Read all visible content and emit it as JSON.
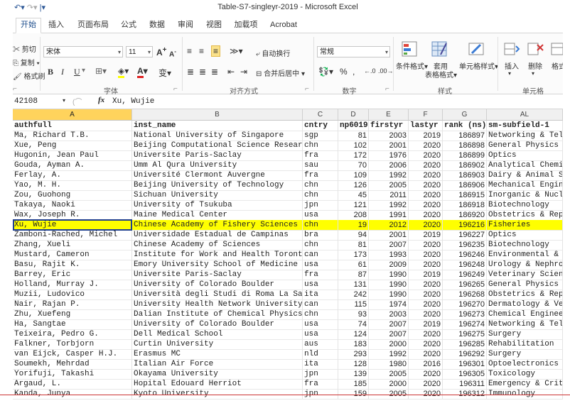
{
  "window": {
    "title": "Table-S7-singleyr-2019 - Microsoft Excel",
    "qat_icons": [
      "excel-app-icon",
      "undo-icon",
      "redo-icon",
      "customize-icon"
    ]
  },
  "tabs": [
    "开始",
    "插入",
    "页面布局",
    "公式",
    "数据",
    "审阅",
    "视图",
    "加载项",
    "Acrobat"
  ],
  "active_tab": "开始",
  "ribbon": {
    "clipboard": {
      "cut": "剪切",
      "copy": "复制",
      "format_painter": "格式刷",
      "label": ""
    },
    "font": {
      "name": "宋体",
      "size": "11",
      "grow": "A",
      "shrink": "A",
      "bold": "B",
      "italic": "I",
      "underline": "U",
      "phonetic": "变",
      "label": "字体"
    },
    "alignment": {
      "wrap": "自动换行",
      "merge": "合并后居中",
      "label": "对齐方式"
    },
    "number": {
      "format": "常规",
      "percent": "%",
      "comma": ",",
      "label": "数字"
    },
    "styles": {
      "conditional": "条件格式",
      "table": "套用\n表格格式",
      "cell": "单元格样式",
      "table_line1": "套用",
      "table_line2": "表格格式",
      "label": "样式"
    },
    "cells": {
      "insert": "插入",
      "delete": "删除",
      "format": "格式",
      "label": "单元格"
    }
  },
  "formula_bar": {
    "name_box": "42108",
    "fx": "fx",
    "content": "Xu, Wujie"
  },
  "columns": [
    {
      "letter": "A",
      "selected": true
    },
    {
      "letter": "B",
      "selected": false
    },
    {
      "letter": "C",
      "selected": false
    },
    {
      "letter": "D",
      "selected": false
    },
    {
      "letter": "E",
      "selected": false
    },
    {
      "letter": "F",
      "selected": false
    },
    {
      "letter": "G",
      "selected": false
    },
    {
      "letter": "AL",
      "selected": false
    }
  ],
  "headers": [
    "authfull",
    "inst_name",
    "cntry",
    "np6019",
    "firstyr",
    "lastyr",
    "rank (ns)",
    "sm-subfield-1"
  ],
  "rows": [
    [
      "Ma, Richard T.B.",
      "National University of Singapore",
      "sgp",
      "81",
      "2003",
      "2019",
      "186897",
      "Networking & Tel"
    ],
    [
      "Xue, Peng",
      "Beijing Computational Science Research",
      "chn",
      "102",
      "2001",
      "2020",
      "186898",
      "General Physics"
    ],
    [
      "Hugonin, Jean Paul",
      "Universite Paris-Saclay",
      "fra",
      "172",
      "1976",
      "2020",
      "186899",
      "Optics"
    ],
    [
      "Gouda, Ayman A.",
      "Umm Al Qura University",
      "sau",
      "70",
      "2006",
      "2020",
      "186902",
      "Analytical Chemi"
    ],
    [
      "Ferlay, A.",
      "Université Clermont Auvergne",
      "fra",
      "109",
      "1992",
      "2020",
      "186903",
      "Dairy & Animal S"
    ],
    [
      "Yao, M. H.",
      "Beijing University of Technology",
      "chn",
      "126",
      "2005",
      "2020",
      "186906",
      "Mechanical Engin"
    ],
    [
      "Zou, Guohong",
      "Sichuan University",
      "chn",
      "45",
      "2011",
      "2020",
      "186915",
      "Inorganic & Nucl"
    ],
    [
      "Takaya, Naoki",
      "University of Tsukuba",
      "jpn",
      "121",
      "1992",
      "2020",
      "186918",
      "Biotechnology"
    ],
    [
      "Wax, Joseph R.",
      "Maine Medical Center",
      "usa",
      "208",
      "1991",
      "2020",
      "186920",
      "Obstetrics & Repr"
    ],
    [
      "Xu, Wujie",
      "Chinese Academy of Fishery Sciences",
      "chn",
      "19",
      "2012",
      "2020",
      "196216",
      "Fisheries"
    ],
    [
      "Zamboni-Rached, Michel",
      "Universidade Estadual de Campinas",
      "bra",
      "94",
      "2001",
      "2019",
      "196227",
      "Optics"
    ],
    [
      "Zhang, Xueli",
      "Chinese Academy of Sciences",
      "chn",
      "81",
      "2007",
      "2020",
      "196235",
      "Biotechnology"
    ],
    [
      "Mustard, Cameron",
      "Institute for Work and Health Toronto",
      "can",
      "173",
      "1993",
      "2020",
      "196246",
      "Environmental & O"
    ],
    [
      "Basu, Rajit K.",
      "Emory University School of Medicine",
      "usa",
      "61",
      "2009",
      "2020",
      "196248",
      "Urology & Nephro"
    ],
    [
      "Barrey, Eric",
      "Universite Paris-Saclay",
      "fra",
      "87",
      "1990",
      "2019",
      "196249",
      "Veterinary Scien"
    ],
    [
      "Holland, Murray J.",
      "University of Colorado Boulder",
      "usa",
      "131",
      "1990",
      "2020",
      "196265",
      "General Physics"
    ],
    [
      "Muzii, Ludovico",
      "Università degli Studi di Roma La Sapi",
      "ita",
      "242",
      "1990",
      "2020",
      "196268",
      "Obstetrics & Repr"
    ],
    [
      "Nair, Rajan P.",
      "University Health Network University o",
      "can",
      "115",
      "1974",
      "2020",
      "196270",
      "Dermatology & Ve"
    ],
    [
      "Zhu, Xuefeng",
      "Dalian Institute of Chemical Physics C",
      "chn",
      "93",
      "2003",
      "2020",
      "196273",
      "Chemical Enginee"
    ],
    [
      "Ha, Sangtae",
      "University of Colorado Boulder",
      "usa",
      "74",
      "2007",
      "2019",
      "196274",
      "Networking & Tel"
    ],
    [
      "Teixeira, Pedro G.",
      "Dell Medical School",
      "usa",
      "124",
      "2007",
      "2020",
      "196275",
      "Surgery"
    ],
    [
      "Falkner, Torbjorn",
      "Curtin University",
      "aus",
      "183",
      "2000",
      "2020",
      "196285",
      "Rehabilitation"
    ],
    [
      "van Eijck, Casper H.J.",
      "Erasmus MC",
      "nld",
      "293",
      "1992",
      "2020",
      "196292",
      "Surgery"
    ],
    [
      "Soumekh, Mehrdad",
      "Italian Air Force",
      "ita",
      "128",
      "1980",
      "2016",
      "196301",
      "Optoelectronics &"
    ],
    [
      "Yorifuji, Takashi",
      "Okayama University",
      "jpn",
      "139",
      "2005",
      "2020",
      "196305",
      "Toxicology"
    ],
    [
      "Argaud, L.",
      "Hopital Edouard Herriot",
      "fra",
      "185",
      "2000",
      "2020",
      "196311",
      "Emergency & Crit"
    ],
    [
      "Kanda, Junya",
      "Kyoto University",
      "jpn",
      "159",
      "2005",
      "2020",
      "196312",
      "Immunology"
    ]
  ],
  "highlight_row_index": 9,
  "colors": {
    "highlight": "#ffff00",
    "selection": "#1f3f8f",
    "accent": "#2b5797"
  }
}
